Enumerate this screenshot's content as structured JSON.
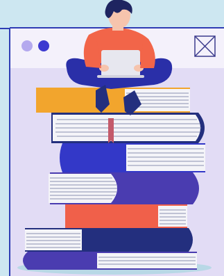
{
  "colors": {
    "background": "#cde7f1",
    "window_bar": "#f4f1fb",
    "window_panel": "#e2dcf5",
    "window_border": "#2f3db4",
    "dot_light": "#b4a9ee",
    "dot_dark": "#3d3ad0",
    "close_icon": "#3b3b8c",
    "ground_shadow": "#b8d8e6",
    "shirt": "#f26549",
    "skin": "#f6c4ad",
    "hair": "#1e2460",
    "pants": "#2a2fa8",
    "laptop": "#e7e7ef",
    "book_orange": "#f2a52d",
    "book_navy": "#232f7e",
    "book_blue": "#3338c8",
    "book_red": "#f0604a",
    "book_purple": "#4a3cb0",
    "pages": "#f4f4f8",
    "page_lines": "#8a8fb0"
  },
  "icons": {
    "window_close": "close-x-icon",
    "browser_dots": "window-dots-icon"
  }
}
